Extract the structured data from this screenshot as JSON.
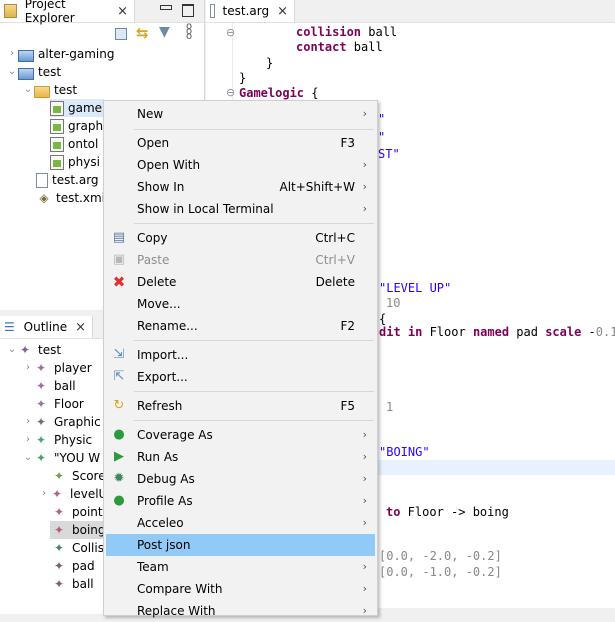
{
  "project_explorer": {
    "title": "Project Explorer",
    "close_label": "×",
    "tree": [
      {
        "label": "alter-gaming",
        "icon": "project-icon",
        "expanded": false
      },
      {
        "label": "test",
        "icon": "project-icon",
        "expanded": true
      },
      {
        "label": "test",
        "icon": "folder-icon",
        "expanded": true
      },
      {
        "label": "game",
        "icon": "editable-file-icon",
        "selected": true
      },
      {
        "label": "graph",
        "icon": "editable-file-icon"
      },
      {
        "label": "ontol",
        "icon": "editable-file-icon"
      },
      {
        "label": "physi",
        "icon": "editable-file-icon"
      },
      {
        "label": "test.arg",
        "icon": "text-file-icon"
      },
      {
        "label": "test.xmi",
        "icon": "xmi-file-icon"
      }
    ]
  },
  "outline": {
    "title": "Outline",
    "close_label": "×",
    "tree": [
      {
        "label": "test",
        "color": "#8060a0"
      },
      {
        "label": "player",
        "color": "#a070a0"
      },
      {
        "label": "ball",
        "color": "#a070a0"
      },
      {
        "label": "Floor",
        "color": "#a070a0"
      },
      {
        "label": "Graphic",
        "color": "#707070"
      },
      {
        "label": "Physic",
        "color": "#50a090"
      },
      {
        "label": "\"YOU W",
        "color": "#50a070"
      },
      {
        "label": "Score",
        "color": "#70a050"
      },
      {
        "label": "levelU",
        "color": "#b06080"
      },
      {
        "label": "point",
        "color": "#b06080"
      },
      {
        "label": "boing",
        "color": "#b06080",
        "selected": true
      },
      {
        "label": "Collis",
        "color": "#508070"
      },
      {
        "label": "pad",
        "color": "#806070"
      },
      {
        "label": "ball",
        "color": "#806070"
      }
    ]
  },
  "editor": {
    "tab_label": "test.arg",
    "close_label": "×",
    "lines": {
      "l1a": "collision",
      "l1b": " ball",
      "l2a": "contact",
      "l2b": " ball",
      "l3": "}",
      "l4": "}",
      "l5a": "Gamelogic",
      "l5b": " {",
      "l6": "\"",
      "l7": "\"",
      "l8": "ST\"",
      "l9": "\"LEVEL UP\"",
      "l10": "10",
      "l11": "{",
      "l12a": "dit ",
      "l12b": "in",
      "l12c": " Floor ",
      "l12d": "named",
      "l12e": " pad ",
      "l12f": "scale",
      "l12g": " -",
      "l12h": "0.1",
      "l13": "1",
      "l14": "\"BOING\"",
      "l15a": "to",
      "l15b": " Floor -> boing",
      "l16": "[0.0, -2.0, -0.2]",
      "l17": "[0.0, -1.0, -0.2]"
    }
  },
  "context_menu": {
    "items": {
      "new": {
        "label": "New",
        "submenu": true
      },
      "open": {
        "label": "Open",
        "shortcut": "F3"
      },
      "open_with": {
        "label": "Open With",
        "submenu": true
      },
      "show_in": {
        "label": "Show In",
        "shortcut": "Alt+Shift+W",
        "submenu": true
      },
      "show_terminal": {
        "label": "Show in Local Terminal",
        "submenu": true
      },
      "copy": {
        "label": "Copy",
        "shortcut": "Ctrl+C"
      },
      "paste": {
        "label": "Paste",
        "shortcut": "Ctrl+V",
        "disabled": true
      },
      "delete": {
        "label": "Delete",
        "shortcut": "Delete"
      },
      "move": {
        "label": "Move..."
      },
      "rename": {
        "label": "Rename...",
        "shortcut": "F2"
      },
      "import": {
        "label": "Import..."
      },
      "export": {
        "label": "Export..."
      },
      "refresh": {
        "label": "Refresh",
        "shortcut": "F5"
      },
      "coverage_as": {
        "label": "Coverage As",
        "submenu": true
      },
      "run_as": {
        "label": "Run As",
        "submenu": true
      },
      "debug_as": {
        "label": "Debug As",
        "submenu": true
      },
      "profile_as": {
        "label": "Profile As",
        "submenu": true
      },
      "acceleo": {
        "label": "Acceleo",
        "submenu": true
      },
      "post_json": {
        "label": "Post json",
        "highlighted": true
      },
      "team": {
        "label": "Team",
        "submenu": true
      },
      "compare_with": {
        "label": "Compare With",
        "submenu": true
      },
      "replace_with": {
        "label": "Replace With",
        "submenu": true
      }
    },
    "submenu_arrow": "›"
  },
  "colors": {
    "menu_highlight": "#91c9f7",
    "keyword": "#7f0055",
    "string": "#2a00ff",
    "selection": "#dbe9f8"
  }
}
